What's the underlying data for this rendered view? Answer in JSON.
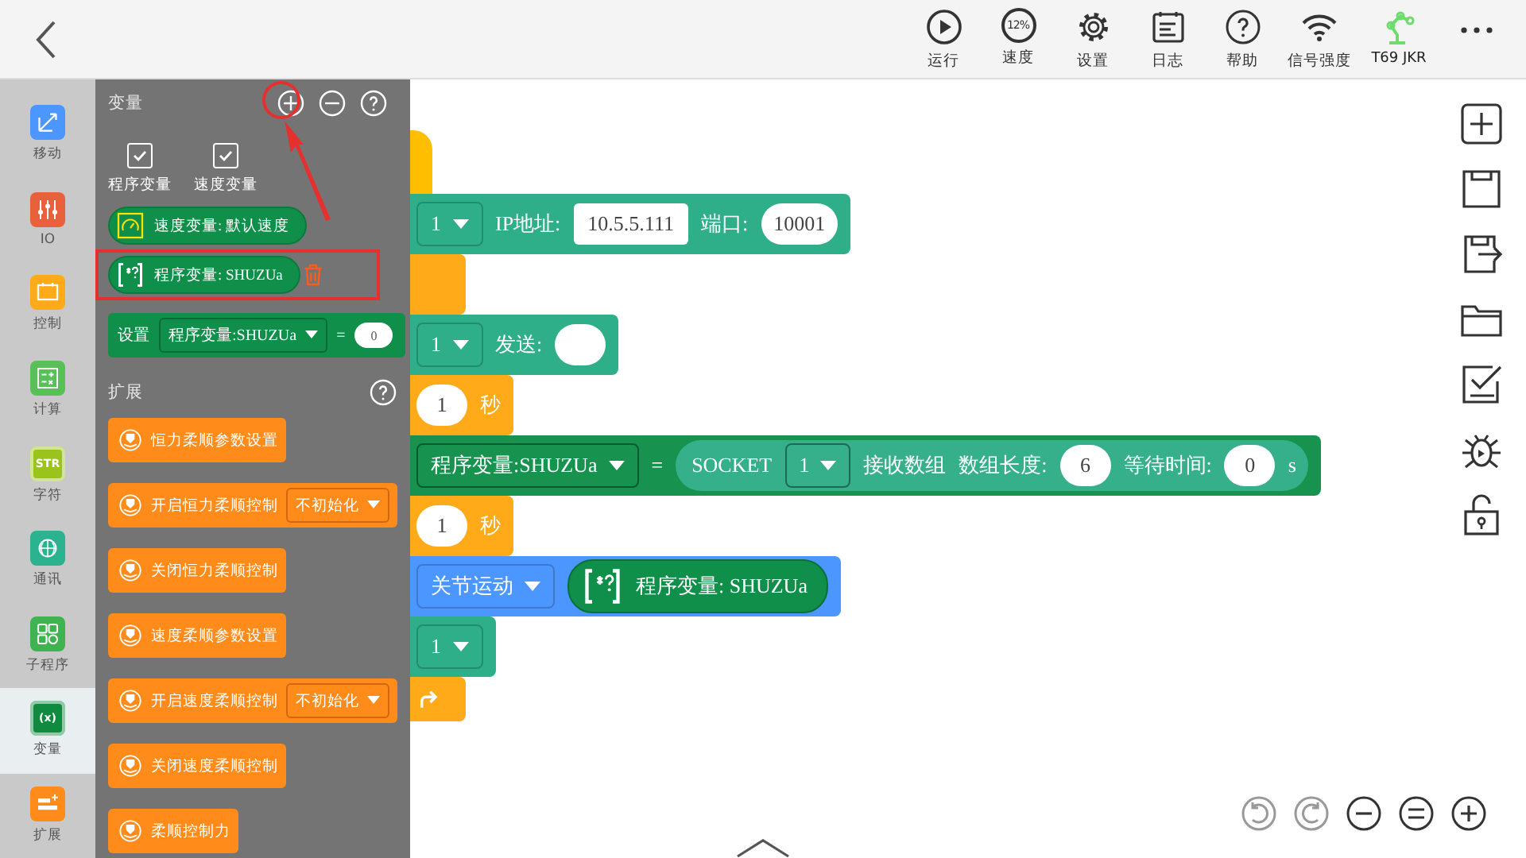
{
  "toolbar": {
    "tools": [
      {
        "kind": "run",
        "label": "运行"
      },
      {
        "kind": "speed",
        "label": "速度",
        "badge": "12%"
      },
      {
        "kind": "settings",
        "label": "设置"
      },
      {
        "kind": "log",
        "label": "日志"
      },
      {
        "kind": "help",
        "label": "帮助"
      },
      {
        "kind": "signal",
        "label": "信号强度"
      },
      {
        "kind": "robot",
        "label": "T69  JKR"
      },
      {
        "kind": "more"
      }
    ]
  },
  "categories": [
    {
      "kind": "move",
      "label": "移动",
      "color": "#4c97ff",
      "selected": false
    },
    {
      "kind": "io",
      "label": "IO",
      "color": "#e8603c",
      "selected": false
    },
    {
      "kind": "control",
      "label": "控制",
      "color": "#ffab19",
      "selected": false
    },
    {
      "kind": "math",
      "label": "计算",
      "color": "#59c059",
      "selected": false
    },
    {
      "kind": "string",
      "label": "字符",
      "color": "#9ac31c",
      "selected": false,
      "glyph": "STR"
    },
    {
      "kind": "comm",
      "label": "通讯",
      "color": "#2bb38f",
      "selected": false
    },
    {
      "kind": "sub",
      "label": "子程序",
      "color": "#3fb34f",
      "selected": false
    },
    {
      "kind": "variable",
      "label": "变量",
      "color": "#0f8a3e",
      "selected": true,
      "glyph": "(x)"
    },
    {
      "kind": "extend",
      "label": "扩展",
      "color": "#ff8c1a",
      "selected": false
    }
  ],
  "flyout": {
    "title": "变量",
    "checkboxes": [
      {
        "label": "程序变量",
        "checked": true
      },
      {
        "label": "速度变量",
        "checked": true
      }
    ],
    "variables": [
      {
        "kind": "speed",
        "label": "速度变量: 默认速度",
        "annotated": false
      },
      {
        "kind": "program",
        "label": "程序变量: SHUZUa",
        "annotated": true
      }
    ],
    "set_block": {
      "label": "设置",
      "variable": "程序变量:SHUZUa",
      "operator": "=",
      "value": "0"
    },
    "section": "扩展",
    "blocks": [
      {
        "label": "恒力柔顺参数设置"
      },
      {
        "label": "开启恒力柔顺控制",
        "option": "不初始化"
      },
      {
        "label": "关闭恒力柔顺控制"
      },
      {
        "label": "速度柔顺参数设置"
      },
      {
        "label": "开启速度柔顺控制",
        "option": "不初始化"
      },
      {
        "label": "关闭速度柔顺控制"
      },
      {
        "label": "柔顺控制力"
      }
    ]
  },
  "canvas": {
    "blocks": [
      {
        "kind": "event"
      },
      {
        "kind": "comm",
        "parts": [
          {
            "kind": "dropdown",
            "text": "1"
          },
          {
            "kind": "label",
            "text": "IP地址:"
          },
          {
            "kind": "field",
            "text": "10.5.5.111"
          },
          {
            "kind": "label",
            "text": "端口:"
          },
          {
            "kind": "oval",
            "text": "10001"
          }
        ]
      },
      {
        "kind": "control"
      },
      {
        "kind": "comm",
        "parts": [
          {
            "kind": "dropdown",
            "text": "1"
          },
          {
            "kind": "label",
            "text": "发送:"
          },
          {
            "kind": "oval"
          }
        ]
      },
      {
        "kind": "control",
        "parts": [
          {
            "kind": "oval",
            "text": "1"
          },
          {
            "kind": "label",
            "text": "秒"
          }
        ]
      },
      {
        "kind": "set",
        "parts": [
          {
            "kind": "dropdown",
            "text": "程序变量:SHUZUa"
          },
          {
            "kind": "label",
            "text": "="
          },
          {
            "kind": "reporter",
            "parts": [
              {
                "kind": "label",
                "text": "SOCKET"
              },
              {
                "kind": "dropdown",
                "text": "1"
              },
              {
                "kind": "label",
                "text": "接收数组"
              },
              {
                "kind": "label",
                "text": "数组长度:"
              },
              {
                "kind": "oval",
                "text": "6"
              },
              {
                "kind": "label",
                "text": "等待时间:"
              },
              {
                "kind": "oval",
                "text": "0"
              },
              {
                "kind": "label",
                "text": "s"
              }
            ]
          }
        ]
      },
      {
        "kind": "control",
        "parts": [
          {
            "kind": "oval",
            "text": "1"
          },
          {
            "kind": "label",
            "text": "秒"
          }
        ]
      },
      {
        "kind": "motion",
        "parts": [
          {
            "kind": "dropdown",
            "text": "关节运动"
          },
          {
            "kind": "variable",
            "text": "程序变量: SHUZUa"
          }
        ]
      },
      {
        "kind": "comm",
        "parts": [
          {
            "kind": "dropdown",
            "text": "1"
          }
        ]
      },
      {
        "kind": "control",
        "parts": [
          {
            "kind": "loop_arrow"
          }
        ]
      }
    ]
  },
  "side_tools": [
    {
      "kind": "add"
    },
    {
      "kind": "save"
    },
    {
      "kind": "export"
    },
    {
      "kind": "folder"
    },
    {
      "kind": "checklist"
    },
    {
      "kind": "debug"
    },
    {
      "kind": "lock"
    }
  ],
  "zoom_controls": [
    {
      "kind": "undo"
    },
    {
      "kind": "redo"
    },
    {
      "kind": "zoom_out"
    },
    {
      "kind": "reset"
    },
    {
      "kind": "zoom_in"
    }
  ]
}
